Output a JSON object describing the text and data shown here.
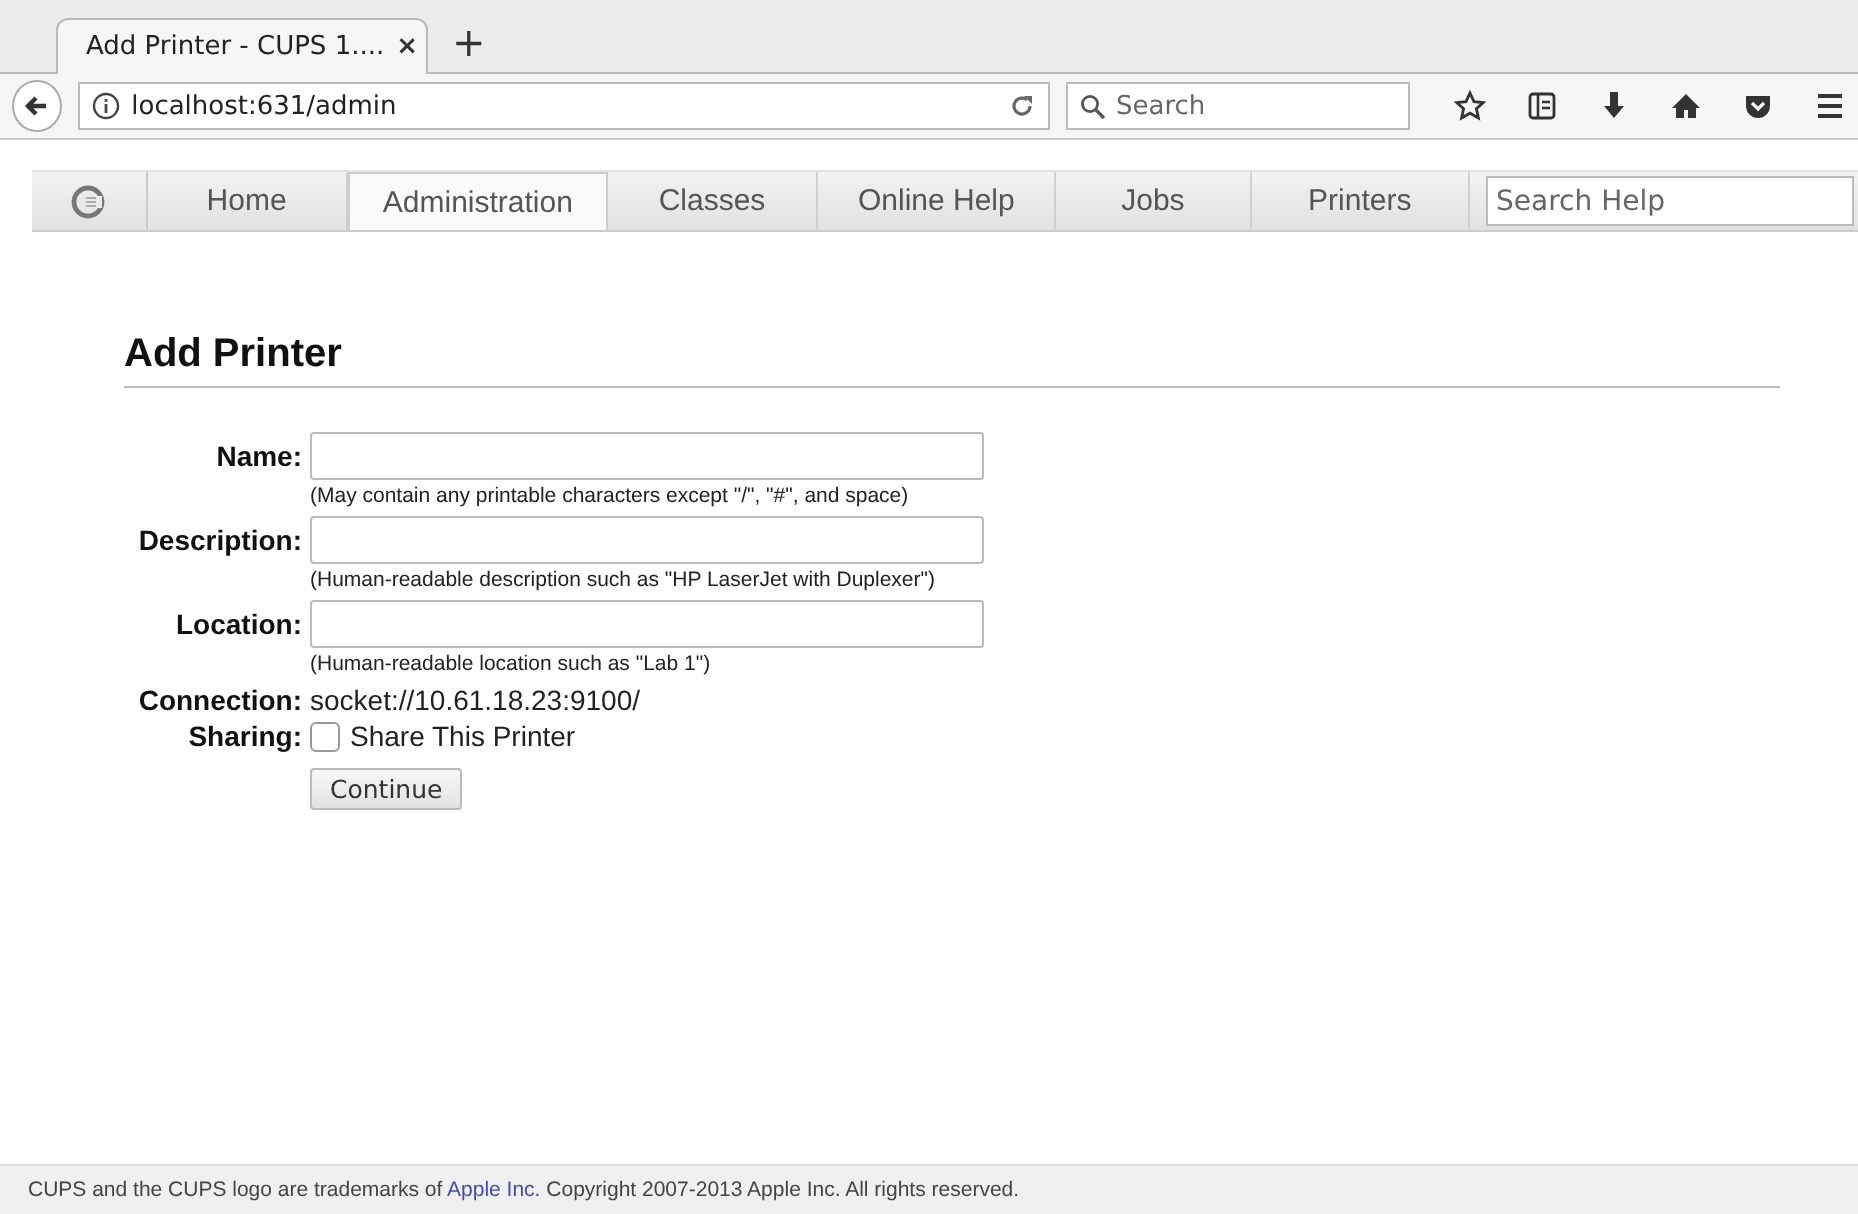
{
  "browser": {
    "tab": {
      "title": "Add Printer - CUPS 1....",
      "close": "×",
      "selected": true
    },
    "new_tab": "+",
    "url": "localhost:631/admin",
    "search": {
      "placeholder": "Search"
    }
  },
  "nav": {
    "items": [
      {
        "label": "Home",
        "selected": false
      },
      {
        "label": "Administration",
        "selected": true
      },
      {
        "label": "Classes",
        "selected": false
      },
      {
        "label": "Online Help",
        "selected": false
      },
      {
        "label": "Jobs",
        "selected": false
      },
      {
        "label": "Printers",
        "selected": false
      }
    ],
    "search": {
      "placeholder": "Search Help"
    }
  },
  "form": {
    "title": "Add Printer",
    "rows": [
      {
        "kind": "text",
        "label": "Name:",
        "hint": "(May contain any printable characters except \"/\", \"#\", and space)"
      },
      {
        "kind": "text",
        "label": "Description:",
        "hint": "(Human-readable description such as \"HP LaserJet with Duplexer\")"
      },
      {
        "kind": "text",
        "label": "Location:",
        "hint": "(Human-readable location such as \"Lab 1\")"
      },
      {
        "kind": "static",
        "label": "Connection:",
        "value": "socket://10.61.18.23:9100/"
      },
      {
        "kind": "checkbox",
        "label": "Sharing:",
        "text": "Share This Printer",
        "checked": false
      }
    ],
    "button": "Continue"
  },
  "footer": {
    "before": "CUPS and the CUPS logo are trademarks of ",
    "link": "Apple Inc.",
    "after": " Copyright 2007-2013 Apple Inc. All rights reserved."
  }
}
